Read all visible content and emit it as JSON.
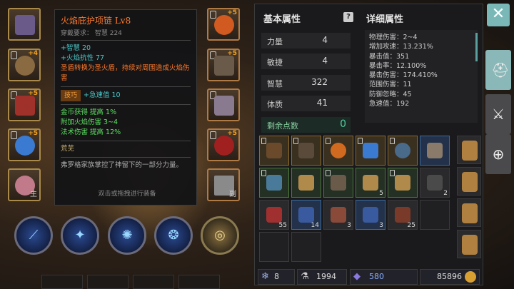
{
  "tooltip": {
    "name": "火焰庇护项链 Lv8",
    "requirement": "穿戴要求：   智慧 224",
    "stats": [
      "+智慧 20",
      "+火焰抗性 77"
    ],
    "effect": "圣盾转换为圣火盾，持续对周围造成火焰伤害",
    "skill_tag": "技巧",
    "skill_bonus": "+急速值 10",
    "bonuses": [
      "金币获得 提高 1%",
      "附加火焰伤害 3~4",
      "法术伤害 提高 12%"
    ],
    "rarity": "荒芜",
    "lore": "弗罗格家族掌控了神留下的一部分力量。",
    "hint": "双击或拖拽进行装备"
  },
  "equipment": {
    "left": [
      {
        "name": "helmet",
        "plus": ""
      },
      {
        "name": "armor",
        "plus": "+4"
      },
      {
        "name": "chest",
        "plus": "+5"
      },
      {
        "name": "ring",
        "plus": "+5"
      },
      {
        "name": "offhand",
        "label": "主"
      }
    ],
    "right": [
      {
        "name": "amulet",
        "plus": "+5"
      },
      {
        "name": "gloves",
        "plus": "+5"
      },
      {
        "name": "boots",
        "plus": ""
      },
      {
        "name": "orb",
        "plus": "+5"
      },
      {
        "name": "weapon",
        "label": "副"
      }
    ]
  },
  "basic": {
    "title": "基本属性",
    "rows": [
      {
        "k": "力量",
        "v": "4"
      },
      {
        "k": "敏捷",
        "v": "4"
      },
      {
        "k": "智慧",
        "v": "322"
      },
      {
        "k": "体质",
        "v": "41"
      }
    ],
    "remain_label": "剩余点数",
    "remain_value": "0"
  },
  "detail": {
    "title": "详细属性",
    "rows": [
      "物理伤害：2~4",
      "增加攻速：13.231%",
      "暴击值：351",
      "暴击率：12.100%",
      "暴击伤害：174.410%",
      "范围伤害：11",
      "防御忽略：45",
      "急速值：192"
    ]
  },
  "inventory": {
    "counts": [
      "",
      "",
      "",
      "",
      "",
      "",
      "",
      "",
      "",
      "5",
      "",
      "2",
      "",
      "",
      "55",
      "14",
      "3",
      "3",
      "25",
      "",
      ""
    ]
  },
  "footer": {
    "gems": "8",
    "potion": "1994",
    "crystal": "580",
    "gold": "85896"
  },
  "colors": {
    "accent": "#7ab8b8",
    "legendary": "#ff7a2a",
    "bonus": "#5be060"
  }
}
